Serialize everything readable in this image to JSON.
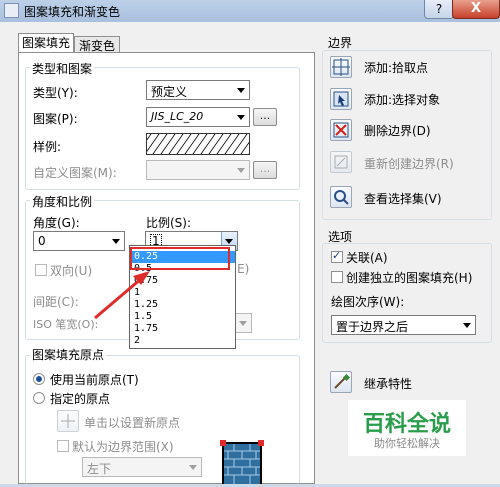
{
  "window": {
    "title": "图案填充和渐变色",
    "help_label": "?",
    "close_label": "X"
  },
  "tabs": [
    {
      "label": "图案填充",
      "active": true
    },
    {
      "label": "渐变色",
      "active": false
    }
  ],
  "type_pattern": {
    "group_label": "类型和图案",
    "type_label": "类型(Y):",
    "type_value": "预定义",
    "pattern_label": "图案(P):",
    "pattern_value": "JIS_LC_20",
    "pattern_btn": "...",
    "swatch_label": "样例:",
    "custom_label": "自定义图案(M):",
    "custom_btn": "..."
  },
  "angle_scale": {
    "group_label": "角度和比例",
    "angle_label": "角度(G):",
    "angle_value": "0",
    "scale_label": "比例(S):",
    "scale_value": "1",
    "double_label": "双向(U)",
    "relative_label": "相对图纸空间(E)",
    "relative_visible": "E)",
    "spacing_label": "间距(C):",
    "iso_label": "ISO 笔宽(O):",
    "scale_options": [
      "0.25",
      "0.5",
      "0.75",
      "1",
      "1.25",
      "1.5",
      "1.75",
      "2"
    ],
    "selected_option": "0.25"
  },
  "origin": {
    "group_label": "图案填充原点",
    "use_current_label": "使用当前原点(T)",
    "specified_label": "指定的原点",
    "click_set_label": "单击以设置新原点",
    "default_extent_label": "默认为边界范围(X)",
    "position_value": "左下"
  },
  "boundary": {
    "group_label": "边界",
    "add_pick_label": "添加:拾取点",
    "add_select_label": "添加:选择对象",
    "remove_label": "删除边界(D)",
    "recreate_label": "重新创建边界(R)",
    "view_label": "查看选择集(V)"
  },
  "options": {
    "group_label": "选项",
    "associative_label": "关联(A)",
    "associative_checked": true,
    "separate_label": "创建独立的图案填充(H)",
    "separate_checked": false,
    "draw_order_label": "绘图次序(W):",
    "draw_order_value": "置于边界之后"
  },
  "inherit": {
    "label": "继承特性"
  },
  "watermark": {
    "title": "百科全说",
    "subtitle": "助你轻松解决"
  },
  "colors": {
    "highlight": "#e02b2b",
    "selection": "#3399ff",
    "watermark_green": "#2a9d4b"
  }
}
